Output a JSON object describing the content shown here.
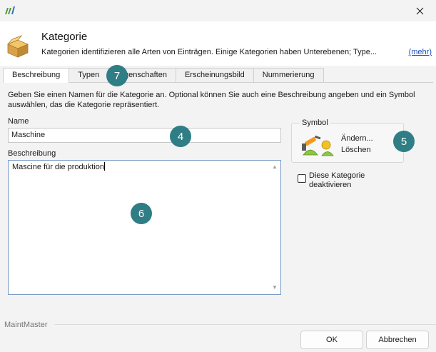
{
  "header": {
    "title": "Kategorie",
    "description": "Kategorien identifizieren alle Arten von Einträgen. Einige Kategorien haben Unterebenen; Type...",
    "more_link": "(mehr)"
  },
  "tabs": [
    {
      "label": "Beschreibung",
      "active": true
    },
    {
      "label": "Typen",
      "active": false
    },
    {
      "label": "Eigenschaften",
      "active": false
    },
    {
      "label": "Erscheinungsbild",
      "active": false
    },
    {
      "label": "Nummerierung",
      "active": false
    }
  ],
  "form": {
    "intro": "Geben Sie einen Namen für die Kategorie an. Optional können Sie auch eine Beschreibung angeben und ein Symbol auswählen, das die Kategorie repräsentiert.",
    "name_label": "Name",
    "name_value": "Maschine",
    "description_label": "Beschreibung",
    "description_value": "Mascine für die produktion"
  },
  "symbol": {
    "legend": "Symbol",
    "change_label": "Ändern...",
    "delete_label": "Löschen"
  },
  "deactivate": {
    "label_line1": "Diese Kategorie",
    "label_line2": "deaktivieren",
    "checked": false
  },
  "badges": {
    "b4": "4",
    "b5": "5",
    "b6": "6",
    "b7": "7"
  },
  "footer": {
    "brand": "MaintMaster",
    "ok_label": "OK",
    "cancel_label": "Abbrechen"
  },
  "colors": {
    "badge": "#2f7d85",
    "link": "#1a4fb3"
  }
}
